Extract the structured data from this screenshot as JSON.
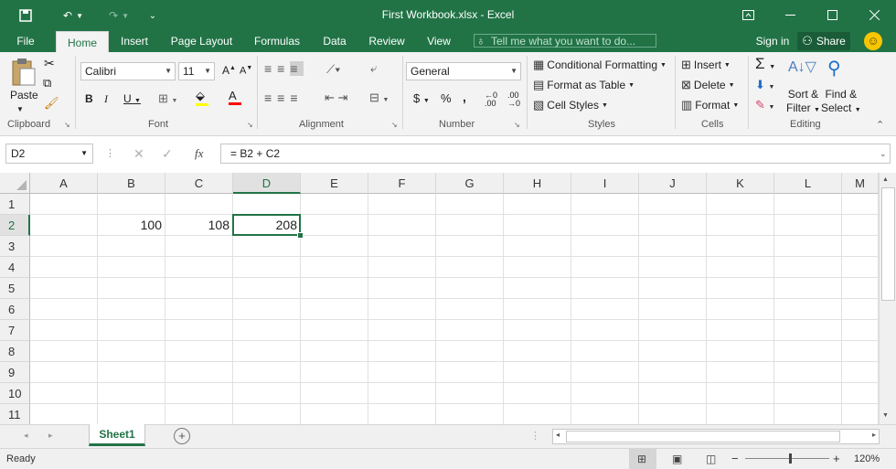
{
  "window": {
    "title": "First Workbook.xlsx - Excel"
  },
  "tabs": [
    "File",
    "Home",
    "Insert",
    "Page Layout",
    "Formulas",
    "Data",
    "Review",
    "View"
  ],
  "tell_me": "Tell me what you want to do...",
  "account": {
    "sign_in": "Sign in",
    "share": "Share"
  },
  "ribbon": {
    "clipboard": {
      "paste": "Paste",
      "label": "Clipboard"
    },
    "font": {
      "name": "Calibri",
      "size": "11",
      "label": "Font"
    },
    "alignment": {
      "label": "Alignment"
    },
    "number": {
      "format": "General",
      "label": "Number"
    },
    "styles": {
      "conditional": "Conditional Formatting",
      "format_table": "Format as Table",
      "cell_styles": "Cell Styles",
      "label": "Styles"
    },
    "cells": {
      "insert": "Insert",
      "delete": "Delete",
      "format": "Format",
      "label": "Cells"
    },
    "editing": {
      "sort": "Sort &",
      "filter": "Filter",
      "find": "Find &",
      "select": "Select",
      "label": "Editing"
    }
  },
  "formula_bar": {
    "name_box": "D2",
    "formula": "= B2 + C2"
  },
  "columns": [
    "A",
    "B",
    "C",
    "D",
    "E",
    "F",
    "G",
    "H",
    "I",
    "J",
    "K",
    "L",
    "M"
  ],
  "rows": [
    "1",
    "2",
    "3",
    "4",
    "5",
    "6",
    "7",
    "8",
    "9",
    "10",
    "11"
  ],
  "cells": {
    "B2": "100",
    "C2": "108",
    "D2": "208"
  },
  "sheet_tabs": [
    "Sheet1"
  ],
  "status": {
    "ready": "Ready",
    "zoom": "120%"
  },
  "colors": {
    "accent": "#217346"
  }
}
